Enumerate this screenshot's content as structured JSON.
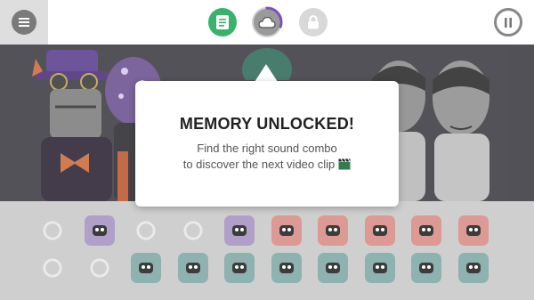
{
  "hud": {
    "menu_icon": "hamburger-menu-icon",
    "left_icon": "notepad-icon",
    "center_icon": "cloud-icon",
    "right_icon": "lock-icon",
    "pause_icon": "pause-icon",
    "center_progress": 0.3,
    "colors": {
      "notepad": "#39b36b",
      "lock": "#cfcfcf",
      "accent": "#7b4fbf"
    }
  },
  "dialog": {
    "title": "MEMORY UNLOCKED!",
    "line1": "Find the right sound combo",
    "line2": "to discover the next video clip",
    "line2_icon": "clapperboard-icon"
  },
  "sound_icons": {
    "row1": [
      {
        "name": "glasses-icon",
        "state": "empty",
        "color": "#c9c9c9"
      },
      {
        "name": "witch-hat-icon",
        "state": "effects",
        "color": "#a693c2"
      },
      {
        "name": "sparkle-icon",
        "state": "empty",
        "color": "#c9c9c9"
      },
      {
        "name": "goggles-icon",
        "state": "empty",
        "color": "#c9c9c9"
      },
      {
        "name": "headband-icon",
        "state": "effects",
        "color": "#a693c2"
      },
      {
        "name": "mask-icon",
        "state": "melody",
        "color": "#d98b84"
      },
      {
        "name": "gas-mask-icon",
        "state": "melody",
        "color": "#d98b84"
      },
      {
        "name": "top-hat-icon",
        "state": "melody",
        "color": "#d98b84"
      },
      {
        "name": "helmet-icon",
        "state": "melody",
        "color": "#d98b84"
      },
      {
        "name": "sunglasses-icon",
        "state": "melody",
        "color": "#d98b84"
      }
    ],
    "row2": [
      {
        "name": "drops-icon",
        "state": "empty",
        "color": "#c9c9c9"
      },
      {
        "name": "arrow-icon",
        "state": "empty",
        "color": "#c9c9c9"
      },
      {
        "name": "face-icon",
        "state": "voice",
        "color": "#7fa8a6"
      },
      {
        "name": "bell-icon",
        "state": "voice",
        "color": "#7fa8a6"
      },
      {
        "name": "cage-icon",
        "state": "voice",
        "color": "#7fa8a6"
      },
      {
        "name": "cap-icon",
        "state": "voice",
        "color": "#7fa8a6"
      },
      {
        "name": "mouth-icon",
        "state": "voice",
        "color": "#7fa8a6"
      },
      {
        "name": "wrench-icon",
        "state": "voice",
        "color": "#7fa8a6"
      },
      {
        "name": "visor-icon",
        "state": "voice",
        "color": "#7fa8a6"
      },
      {
        "name": "antlers-icon",
        "state": "voice",
        "color": "#7fa8a6"
      }
    ]
  }
}
